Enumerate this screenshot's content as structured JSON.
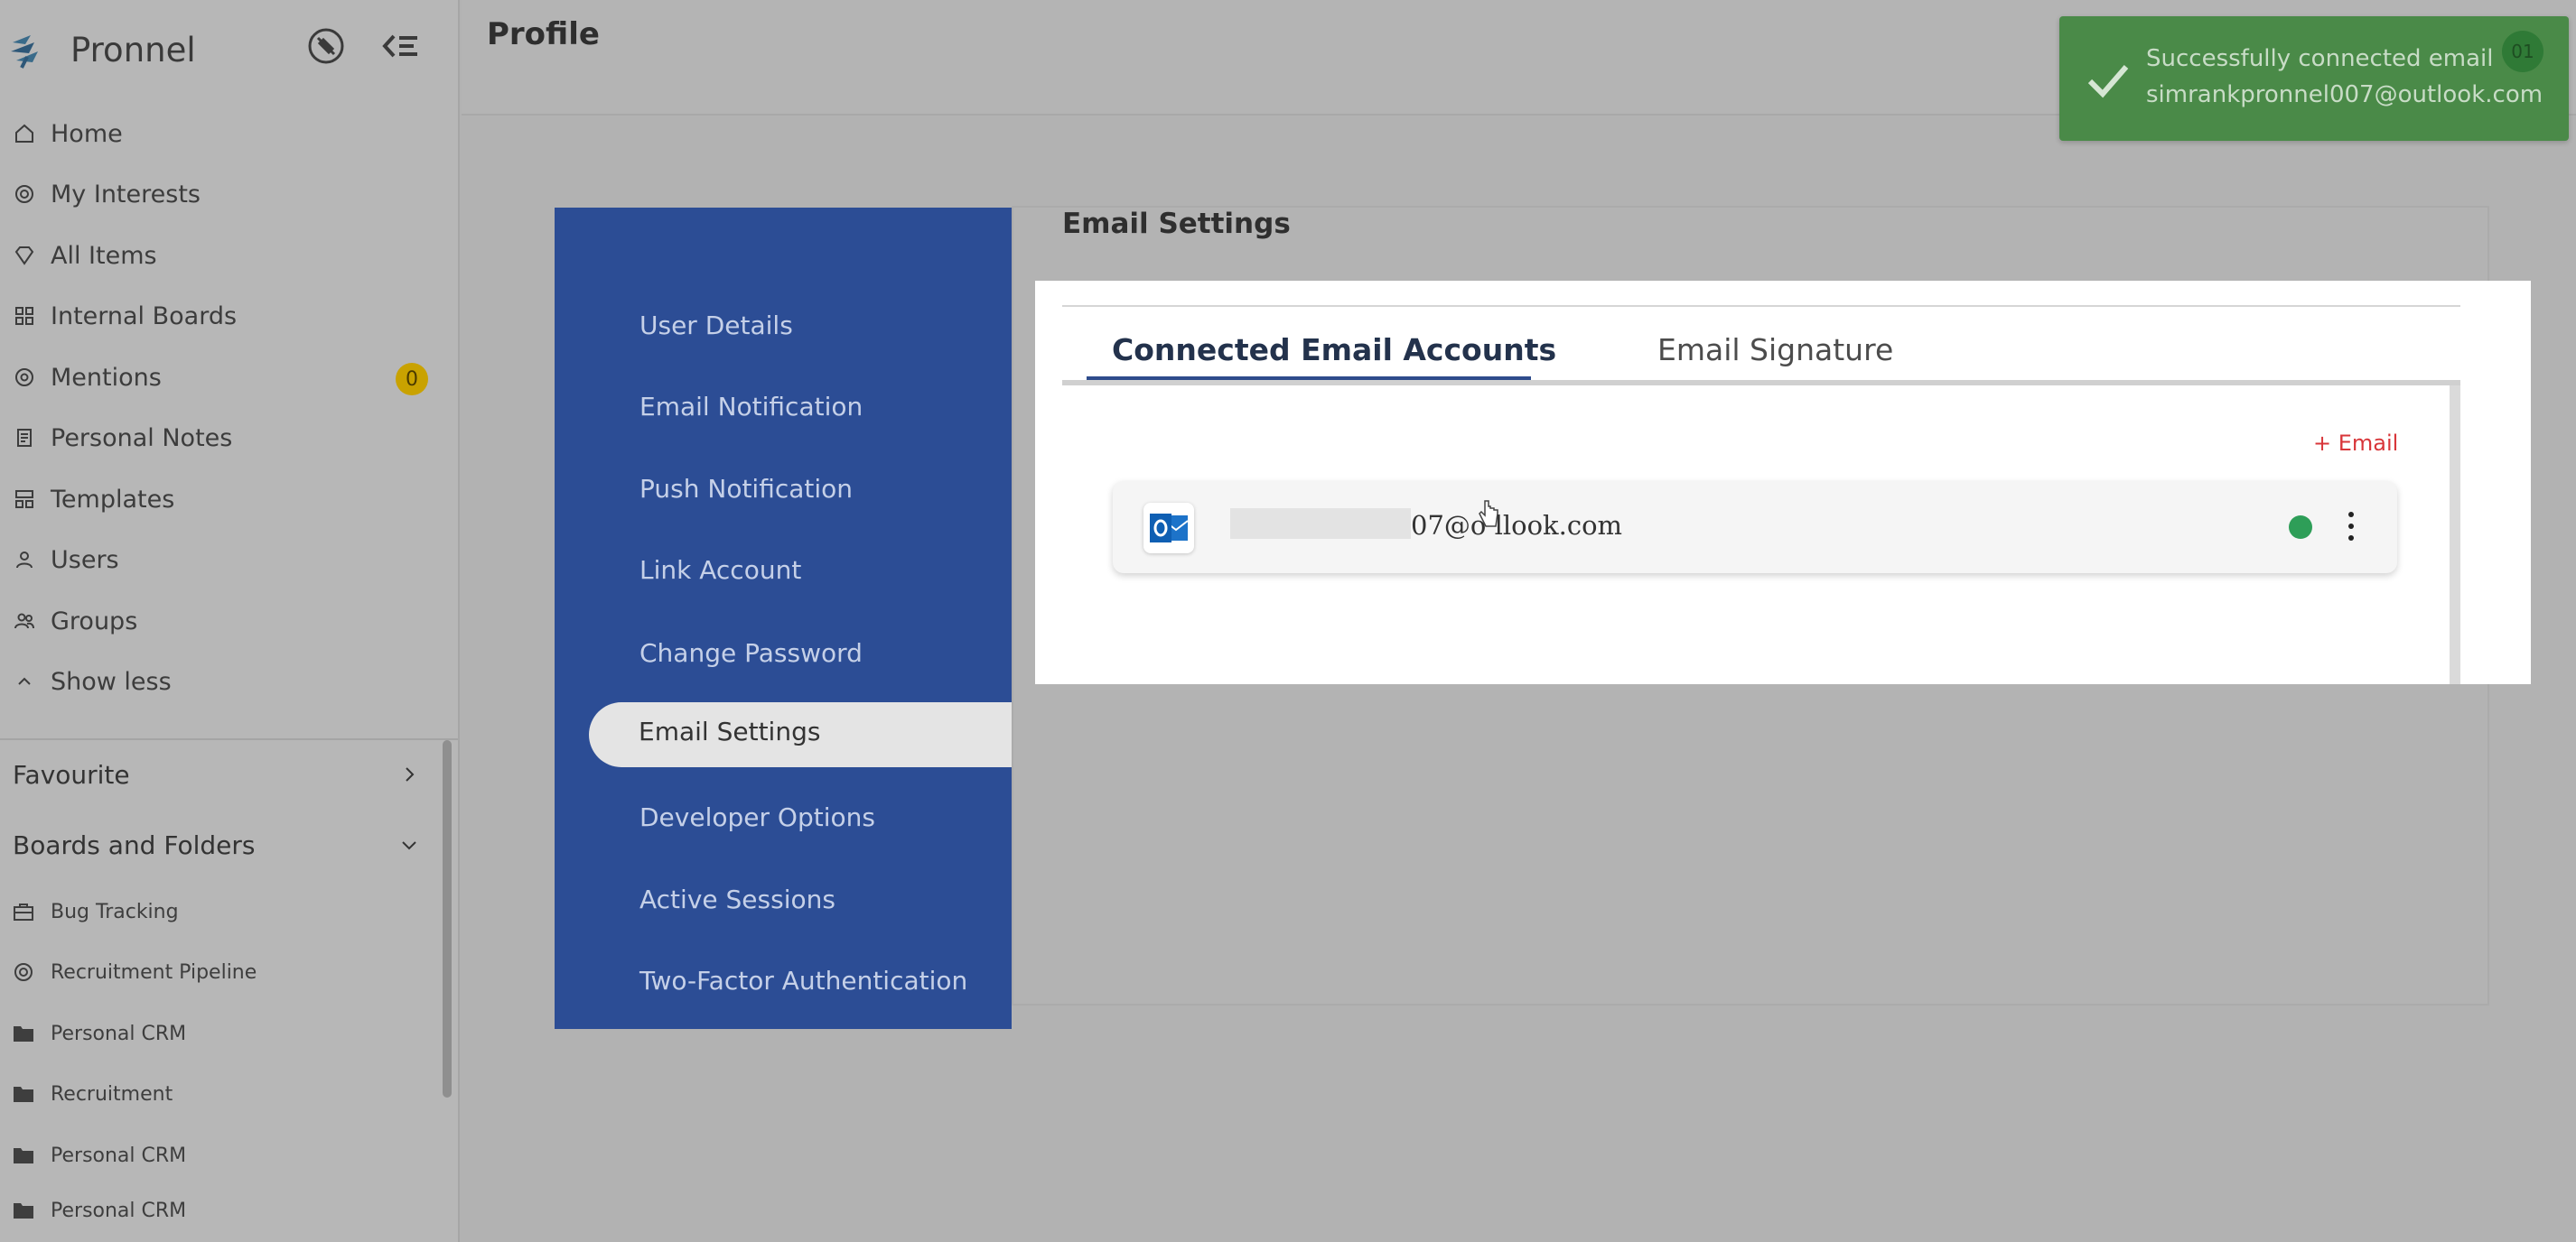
{
  "app": {
    "name": "Pronnel"
  },
  "sidebar": {
    "nav": [
      {
        "label": "Home",
        "icon": "home-icon"
      },
      {
        "label": "My Interests",
        "icon": "target-icon"
      },
      {
        "label": "All Items",
        "icon": "gem-icon"
      },
      {
        "label": "Internal Boards",
        "icon": "grid-icon"
      },
      {
        "label": "Mentions",
        "icon": "at-icon",
        "badge": "0"
      },
      {
        "label": "Personal Notes",
        "icon": "notes-icon"
      },
      {
        "label": "Templates",
        "icon": "template-icon"
      },
      {
        "label": "Users",
        "icon": "user-icon"
      },
      {
        "label": "Groups",
        "icon": "users-icon"
      },
      {
        "label": "Show less",
        "icon": "chevron-up-icon"
      }
    ],
    "sections": {
      "favourite": "Favourite",
      "boards": "Boards and Folders"
    },
    "boards": [
      {
        "label": "Bug Tracking",
        "icon": "briefcase-icon"
      },
      {
        "label": "Recruitment Pipeline",
        "icon": "target-icon"
      },
      {
        "label": "Personal CRM",
        "icon": "folder-icon"
      },
      {
        "label": "Recruitment",
        "icon": "folder-icon"
      },
      {
        "label": "Personal CRM",
        "icon": "folder-icon"
      },
      {
        "label": "Personal CRM",
        "icon": "folder-icon"
      }
    ]
  },
  "header": {
    "title": "Profile",
    "avatar": "01"
  },
  "profile_menu": {
    "items": [
      "User Details",
      "Email Notification",
      "Push Notification",
      "Link Account",
      "Change Password",
      "Email Settings",
      "Developer Options",
      "Active Sessions",
      "Two-Factor Authentication"
    ],
    "active": "Email Settings"
  },
  "email_settings": {
    "title": "Email Settings",
    "tabs": [
      "Connected Email Accounts",
      "Email Signature"
    ],
    "add_label": "+ Email",
    "account": {
      "email": "07@óllook.com",
      "email_display": "07@o llook.com",
      "status_color": "#2e9e58"
    }
  },
  "toast": {
    "line1": "Successfully connected email",
    "line2": "simrankpronnel007@outlook.com"
  },
  "colors": {
    "menu_bg": "#2c4d95",
    "toast_bg": "#4a8a48",
    "accent_red": "#d8363a",
    "badge": "#c9a200"
  }
}
